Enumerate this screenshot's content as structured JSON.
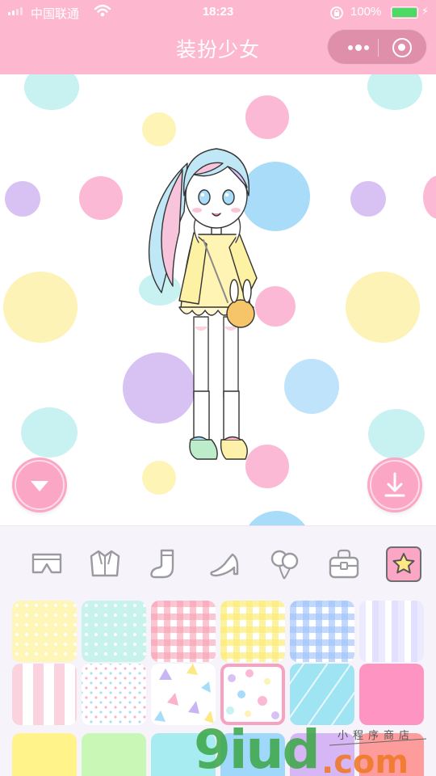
{
  "status": {
    "carrier": "中国联通",
    "time": "18:23",
    "battery_pct": "100%",
    "battery_level": 1.0,
    "charging": true
  },
  "title": "装扮少女",
  "capsule": {
    "more_icon": "more-dots-icon",
    "close_icon": "target-icon"
  },
  "stage": {
    "collapse_icon": "triangle-down-icon",
    "download_icon": "download-icon"
  },
  "categories": [
    {
      "name": "shorts-icon",
      "active": false
    },
    {
      "name": "jacket-icon",
      "active": false
    },
    {
      "name": "socks-icon",
      "active": false
    },
    {
      "name": "high-heel-icon",
      "active": false
    },
    {
      "name": "balloons-icon",
      "active": false
    },
    {
      "name": "bag-icon",
      "active": false
    },
    {
      "name": "star-background-icon",
      "active": true
    }
  ],
  "backgrounds": [
    {
      "pattern": "yellow-dots",
      "selected": false
    },
    {
      "pattern": "mint-dots",
      "selected": false
    },
    {
      "pattern": "pink-gingham",
      "selected": false
    },
    {
      "pattern": "yellow-gingham",
      "selected": false
    },
    {
      "pattern": "blue-gingham",
      "selected": false
    },
    {
      "pattern": "lavender-stripes",
      "selected": false
    },
    {
      "pattern": "pink-stripes",
      "selected": false
    },
    {
      "pattern": "confetti-dots",
      "selected": false
    },
    {
      "pattern": "pastel-triangles",
      "selected": false
    },
    {
      "pattern": "pastel-polka",
      "selected": true
    },
    {
      "pattern": "aqua-diagonal",
      "selected": false
    },
    {
      "pattern": "solid-pink",
      "selected": false
    },
    {
      "pattern": "solid-yellow",
      "selected": false
    },
    {
      "pattern": "solid-green",
      "selected": false
    },
    {
      "pattern": "solid-aqua",
      "selected": false
    },
    {
      "pattern": "solid-blue",
      "selected": false
    },
    {
      "pattern": "solid-purple",
      "selected": false
    },
    {
      "pattern": "solid-salmon",
      "selected": false
    }
  ],
  "watermark": {
    "logo": "9iud",
    "domain": ".com",
    "tagline": "小程序商店"
  },
  "colors": {
    "accent_pink": "#fdb8d0",
    "button_pink": "#fca6c6",
    "panel_bg": "#f6f3fa",
    "icon_gray": "#9a9aa0"
  }
}
